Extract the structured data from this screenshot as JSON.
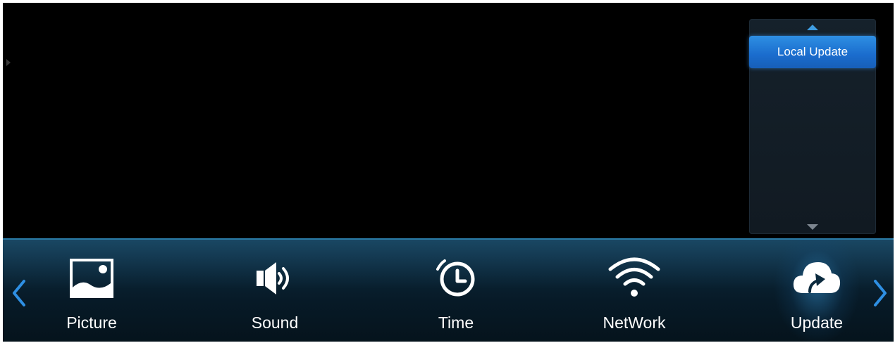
{
  "submenu": {
    "items": [
      {
        "label": "Local Update",
        "selected": true
      }
    ],
    "scroll_up_icon": "triangle-up",
    "scroll_down_icon": "triangle-down"
  },
  "menu": {
    "items": [
      {
        "label": "Picture",
        "icon": "picture-icon"
      },
      {
        "label": "Sound",
        "icon": "speaker-icon"
      },
      {
        "label": "Time",
        "icon": "clock-icon"
      },
      {
        "label": "NetWork",
        "icon": "wifi-icon"
      },
      {
        "label": "Update",
        "icon": "cloud-upload-icon",
        "selected": true
      }
    ],
    "prev_icon": "chevron-left",
    "next_icon": "chevron-right"
  },
  "colors": {
    "accent": "#1f7fd9",
    "nav_arrow": "#2e8fe3",
    "menubar": "#0a2435",
    "text": "#ffffff"
  }
}
